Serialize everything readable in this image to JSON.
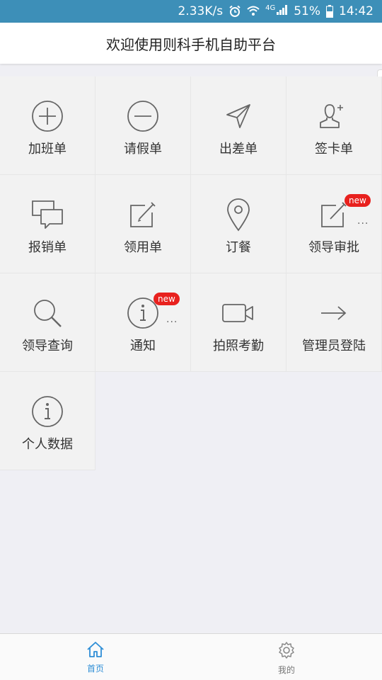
{
  "status_bar": {
    "speed": "2.33K/s",
    "network": "4G",
    "battery": "51%",
    "time": "14:42"
  },
  "header": {
    "title": "欢迎使用则科手机自助平台"
  },
  "tiles": [
    {
      "label": "加班单",
      "icon": "plus-circle-icon"
    },
    {
      "label": "请假单",
      "icon": "minus-circle-icon"
    },
    {
      "label": "出差单",
      "icon": "paper-plane-icon"
    },
    {
      "label": "签卡单",
      "icon": "user-add-icon"
    },
    {
      "label": "报销单",
      "icon": "chat-bubbles-icon"
    },
    {
      "label": "领用单",
      "icon": "edit-icon"
    },
    {
      "label": "订餐",
      "icon": "location-pin-icon"
    },
    {
      "label": "领导审批",
      "icon": "edit-icon",
      "badge": "new",
      "dots": "..."
    },
    {
      "label": "领导查询",
      "icon": "search-icon"
    },
    {
      "label": "通知",
      "icon": "info-circle-icon",
      "badge": "new",
      "dots": "..."
    },
    {
      "label": "拍照考勤",
      "icon": "video-camera-icon"
    },
    {
      "label": "管理员登陆",
      "icon": "arrow-right-icon"
    },
    {
      "label": "个人数据",
      "icon": "info-circle-icon"
    }
  ],
  "bottom_nav": {
    "items": [
      {
        "label": "首页",
        "icon": "home-icon",
        "active": true
      },
      {
        "label": "我的",
        "icon": "gear-icon",
        "active": false
      }
    ]
  },
  "colors": {
    "status_bar": "#3d8fb8",
    "accent": "#2e8ed6",
    "badge": "#e8211e",
    "icon_stroke": "#666666"
  }
}
